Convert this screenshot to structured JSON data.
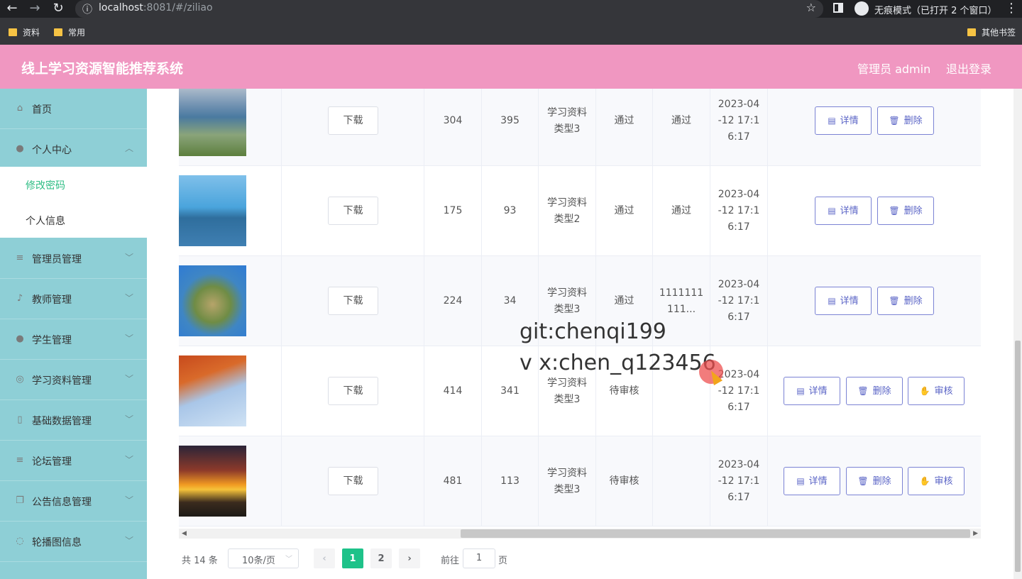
{
  "browser": {
    "url_host": "localhost",
    "url_rest": ":8081/#/ziliao",
    "incognito_label": "无痕模式（已打开 2 个窗口）",
    "bookmarks": [
      "资料",
      "常用"
    ],
    "other_bookmarks": "其他书签"
  },
  "header": {
    "title": "线上学习资源智能推荐系统",
    "user": "管理员 admin",
    "logout": "退出登录"
  },
  "sidebar": {
    "items": [
      {
        "label": "首页",
        "icon": "home-icon"
      },
      {
        "label": "个人中心",
        "icon": "user-icon"
      },
      {
        "label": "管理员管理",
        "icon": "list-icon"
      },
      {
        "label": "教师管理",
        "icon": "mic-icon"
      },
      {
        "label": "学生管理",
        "icon": "location-icon"
      },
      {
        "label": "学习资料管理",
        "icon": "compass-icon"
      },
      {
        "label": "基础数据管理",
        "icon": "phone-icon"
      },
      {
        "label": "论坛管理",
        "icon": "list-icon"
      },
      {
        "label": "公告信息管理",
        "icon": "copy-icon"
      },
      {
        "label": "轮播图信息",
        "icon": "bell-off-icon"
      }
    ],
    "submenu": [
      {
        "label": "修改密码",
        "active": true
      },
      {
        "label": "个人信息",
        "active": false
      }
    ]
  },
  "table": {
    "download_label": "下载",
    "detail_label": "详情",
    "delete_label": "删除",
    "review_label": "审核",
    "rows": [
      {
        "col1": "304",
        "col2": "395",
        "type1": "学习资料",
        "type2": "类型3",
        "status": "通过",
        "reply": "通过",
        "t1": "2023-04",
        "t2": "-12 17:1",
        "t3": "6:17",
        "review": false,
        "thumb": "sea"
      },
      {
        "col1": "175",
        "col2": "93",
        "type1": "学习资料",
        "type2": "类型2",
        "status": "通过",
        "reply": "通过",
        "t1": "2023-04",
        "t2": "-12 17:1",
        "t3": "6:17",
        "review": false,
        "thumb": "lake"
      },
      {
        "col1": "224",
        "col2": "34",
        "type1": "学习资料",
        "type2": "类型3",
        "status": "通过",
        "reply": "1111111",
        "reply2": "111...",
        "t1": "2023-04",
        "t2": "-12 17:1",
        "t3": "6:17",
        "review": false,
        "thumb": "globe"
      },
      {
        "col1": "414",
        "col2": "341",
        "type1": "学习资料",
        "type2": "类型3",
        "status": "待审核",
        "reply": "",
        "t1": "2023-04",
        "t2": "-12 17:1",
        "t3": "6:17",
        "review": true,
        "thumb": "leaves"
      },
      {
        "col1": "481",
        "col2": "113",
        "type1": "学习资料",
        "type2": "类型3",
        "status": "待审核",
        "reply": "",
        "t1": "2023-04",
        "t2": "-12 17:1",
        "t3": "6:17",
        "review": true,
        "thumb": "sunset"
      }
    ]
  },
  "pagination": {
    "total": "共 14 条",
    "page_size": "10条/页",
    "pages": [
      "1",
      "2"
    ],
    "current": "1",
    "goto": "前往",
    "goto_value": "1",
    "unit": "页"
  },
  "watermark": {
    "line1": "git:chenqi199",
    "line2": "v x:chen_q123456"
  }
}
